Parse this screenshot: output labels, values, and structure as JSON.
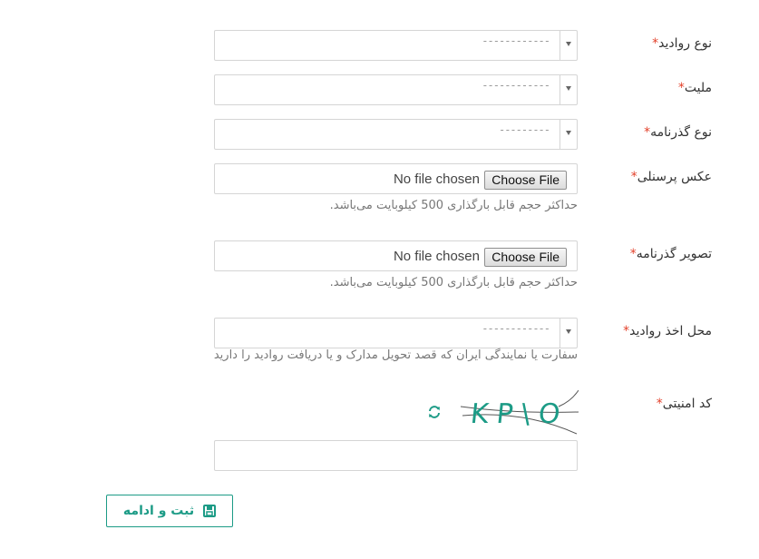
{
  "form": {
    "required_mark": "*",
    "visa_type": {
      "label": "نوع روادید",
      "placeholder": "------------"
    },
    "nationality": {
      "label": "ملیت",
      "placeholder": "------------"
    },
    "passport_type": {
      "label": "نوع گذرنامه",
      "placeholder": "---------"
    },
    "personal_photo": {
      "label": "عکس پرسنلی",
      "button": "Choose File",
      "status": "No file chosen",
      "hint": "حداکثر حجم قابل بارگذاری 500 کیلوبایت می‌باشد."
    },
    "passport_image": {
      "label": "تصویر گذرنامه",
      "button": "Choose File",
      "status": "No file chosen",
      "hint": "حداکثر حجم قابل بارگذاری 500 کیلوبایت می‌باشد."
    },
    "visa_location": {
      "label": "محل اخذ روادید",
      "placeholder": "------------",
      "hint": "سفارت یا نمایندگی ایران که قصد تحویل مدارک و یا دریافت روادید را دارید"
    },
    "security_code": {
      "label": "کد امنیتی",
      "captcha_text": "KP\\O",
      "refresh_icon": "refresh-icon",
      "value": ""
    },
    "submit": {
      "label": "ثبت و ادامه",
      "icon": "save-icon"
    }
  },
  "colors": {
    "accent": "#1c9b86",
    "required": "#e3412b",
    "border": "#d5d5d5",
    "hint": "#777777"
  }
}
